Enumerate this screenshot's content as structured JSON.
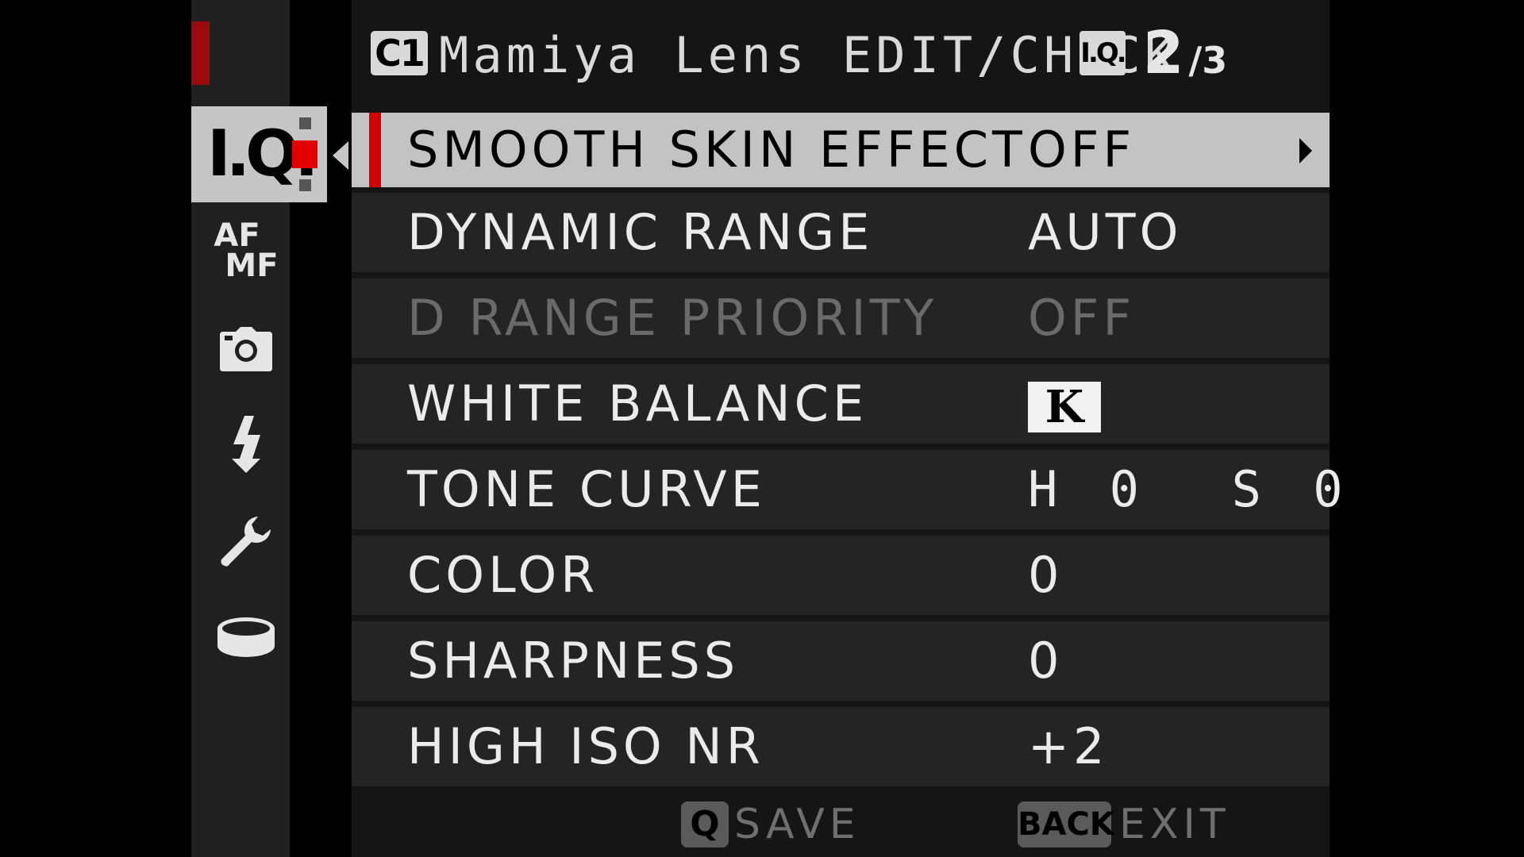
{
  "header": {
    "custom_slot": "C1",
    "title": "Mamiya Lens EDIT/CHECK",
    "menu_badge": "I.Q.",
    "page_current": "2",
    "page_total": "/3"
  },
  "tabs": {
    "active_label": "I.Q.",
    "af_mf_top": "AF",
    "af_mf_bottom": "MF",
    "items": [
      {
        "name": "image-quality",
        "icon": "iq-icon"
      },
      {
        "name": "af-mf",
        "icon": "af-mf-icon"
      },
      {
        "name": "shooting",
        "icon": "camera-icon"
      },
      {
        "name": "flash",
        "icon": "flash-icon"
      },
      {
        "name": "setup",
        "icon": "wrench-icon"
      },
      {
        "name": "my-menu",
        "icon": "ring-icon"
      }
    ]
  },
  "rows": [
    {
      "label": "SMOOTH SKIN EFFECT",
      "value": "OFF",
      "state": "selected"
    },
    {
      "label": "DYNAMIC RANGE",
      "value": "AUTO",
      "state": "normal"
    },
    {
      "label": "D RANGE PRIORITY",
      "value": "OFF",
      "state": "disabled"
    },
    {
      "label": "WHITE BALANCE",
      "value": "K",
      "state": "normal"
    },
    {
      "label": "TONE CURVE",
      "value": "H 0  S 0",
      "state": "normal"
    },
    {
      "label": "COLOR",
      "value": "0",
      "state": "normal"
    },
    {
      "label": "SHARPNESS",
      "value": "0",
      "state": "normal"
    },
    {
      "label": "HIGH ISO NR",
      "value": "+2",
      "state": "normal"
    }
  ],
  "footer": {
    "save_key": "Q",
    "save_label": "SAVE",
    "exit_key": "BACK",
    "exit_label": "EXIT"
  },
  "colors": {
    "accent": "#d40000",
    "selected_row": "#c3c3c3",
    "row": "#242424",
    "background": "#151515"
  }
}
